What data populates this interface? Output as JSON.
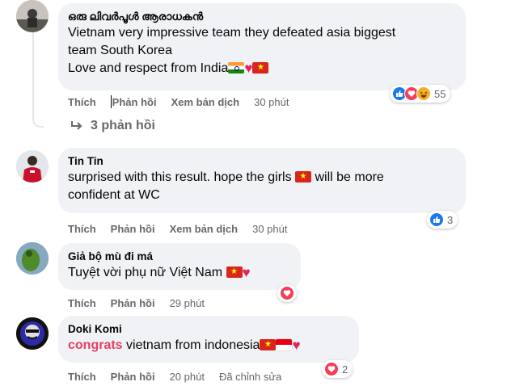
{
  "colors": {
    "bubble_bg": "#f0f2f5",
    "secondary_text": "#65676b",
    "like_blue": "#1877f2",
    "love_red": "#f33e58",
    "highlight_pink": "#e4405f"
  },
  "comments": [
    {
      "author": "ഒരു ലിവർപൂൾ ആരാധകൻ",
      "lines": [
        "Vietnam very impressive team they defeated asia biggest",
        "team South Korea",
        "Love and respect from India"
      ],
      "emojis": [
        "flag-india",
        "red-heart",
        "flag-vietnam"
      ],
      "actions": {
        "like": "Thích",
        "reply": "Phản hồi",
        "translate": "Xem bản dịch",
        "time": "30 phút"
      },
      "reactions": {
        "types": [
          "like",
          "love",
          "haha"
        ],
        "count": "55"
      },
      "replies_link": "3 phản hồi"
    },
    {
      "author": "Tin Tin",
      "line1_before": "surprised with this result. hope the girls ",
      "line1_after": " will be more",
      "line2": "confident at WC",
      "emojis": [
        "flag-vietnam"
      ],
      "actions": {
        "like": "Thích",
        "reply": "Phản hồi",
        "translate": "Xem bản dịch",
        "time": "30 phút"
      },
      "reactions": {
        "types": [
          "like"
        ],
        "count": "3"
      }
    },
    {
      "author": "Giả bộ mù đi má",
      "text": "Tuyệt vời phụ nữ Việt Nam ",
      "emojis": [
        "flag-vietnam",
        "red-heart"
      ],
      "actions": {
        "like": "Thích",
        "reply": "Phản hồi",
        "time": "29 phút"
      },
      "reactions": {
        "types": [
          "love"
        ],
        "count": ""
      }
    },
    {
      "author": "Doki Komi",
      "highlight": "congrats",
      "text": " vietnam from indonesia",
      "emojis": [
        "flag-vietnam",
        "flag-indonesia",
        "red-heart"
      ],
      "actions": {
        "like": "Thích",
        "reply": "Phản hồi",
        "time": "20 phút",
        "edited": "Đã chỉnh sửa"
      },
      "reactions": {
        "types": [
          "love"
        ],
        "count": "2"
      }
    }
  ]
}
